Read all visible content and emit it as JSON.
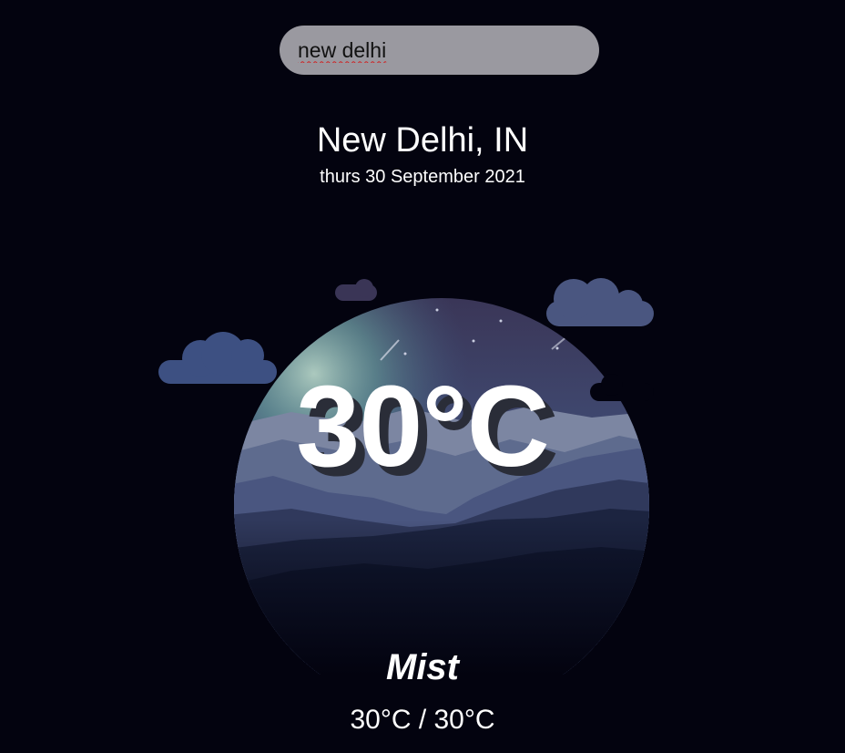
{
  "search": {
    "value": "new delhi"
  },
  "weather": {
    "location": "New Delhi, IN",
    "date": "thurs 30 September 2021",
    "temperature": "30°C",
    "condition": "Mist",
    "range": "30°C / 30°C"
  }
}
